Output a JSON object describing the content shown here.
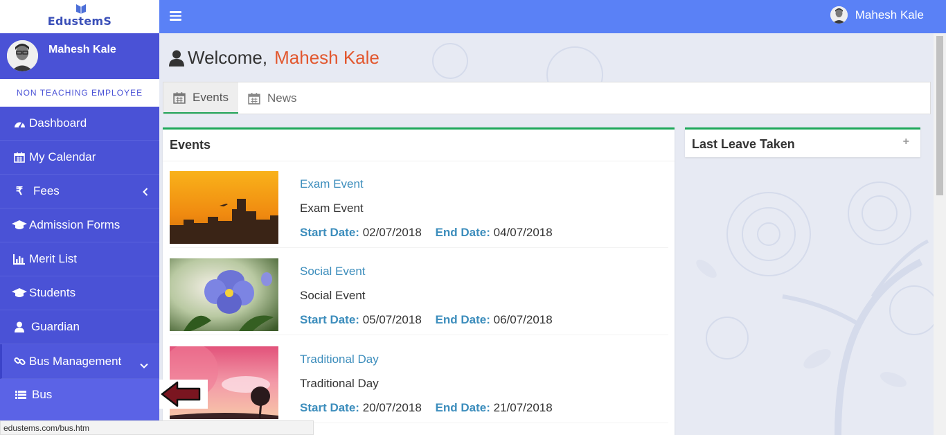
{
  "brand": {
    "logo_text": "EdustemS"
  },
  "user": {
    "name": "Mahesh Kale",
    "role": "NON TEACHING EMPLOYEE"
  },
  "sidebar": {
    "items": [
      {
        "label": "Dashboard",
        "icon": "dashboard-icon"
      },
      {
        "label": "My Calendar",
        "icon": "calendar-icon"
      },
      {
        "label": "Fees",
        "icon": "rupee-icon"
      },
      {
        "label": "Admission Forms",
        "icon": "graduation-cap-icon"
      },
      {
        "label": "Merit List",
        "icon": "bar-chart-icon"
      },
      {
        "label": "Students",
        "icon": "graduation-cap-icon"
      },
      {
        "label": "Guardian",
        "icon": "user-icon"
      },
      {
        "label": "Bus Management",
        "icon": "link-icon"
      }
    ],
    "submenu": [
      {
        "label": "Bus",
        "icon": "list-icon"
      }
    ]
  },
  "welcome": {
    "greeting": "Welcome,",
    "name": "Mahesh Kale"
  },
  "tabs": [
    {
      "label": "Events",
      "active": true
    },
    {
      "label": "News",
      "active": false
    }
  ],
  "events_panel": {
    "title": "Events",
    "start_label": "Start Date:",
    "end_label": "End Date:",
    "items": [
      {
        "title": "Exam Event",
        "description": "Exam Event",
        "start": "02/07/2018",
        "end": "04/07/2018"
      },
      {
        "title": "Social Event",
        "description": "Social Event",
        "start": "05/07/2018",
        "end": "06/07/2018"
      },
      {
        "title": "Traditional Day",
        "description": "Traditional Day",
        "start": "20/07/2018",
        "end": "21/07/2018"
      }
    ]
  },
  "leave_panel": {
    "title": "Last Leave Taken",
    "expand_symbol": "+"
  },
  "status_url": "edustems.com/bus.htm",
  "colors": {
    "sidebar": "#4a52d6",
    "topbar": "#5a81f6",
    "accent_green": "#1ea85a",
    "link_blue": "#3c8dbc",
    "name_orange": "#e2572e"
  }
}
